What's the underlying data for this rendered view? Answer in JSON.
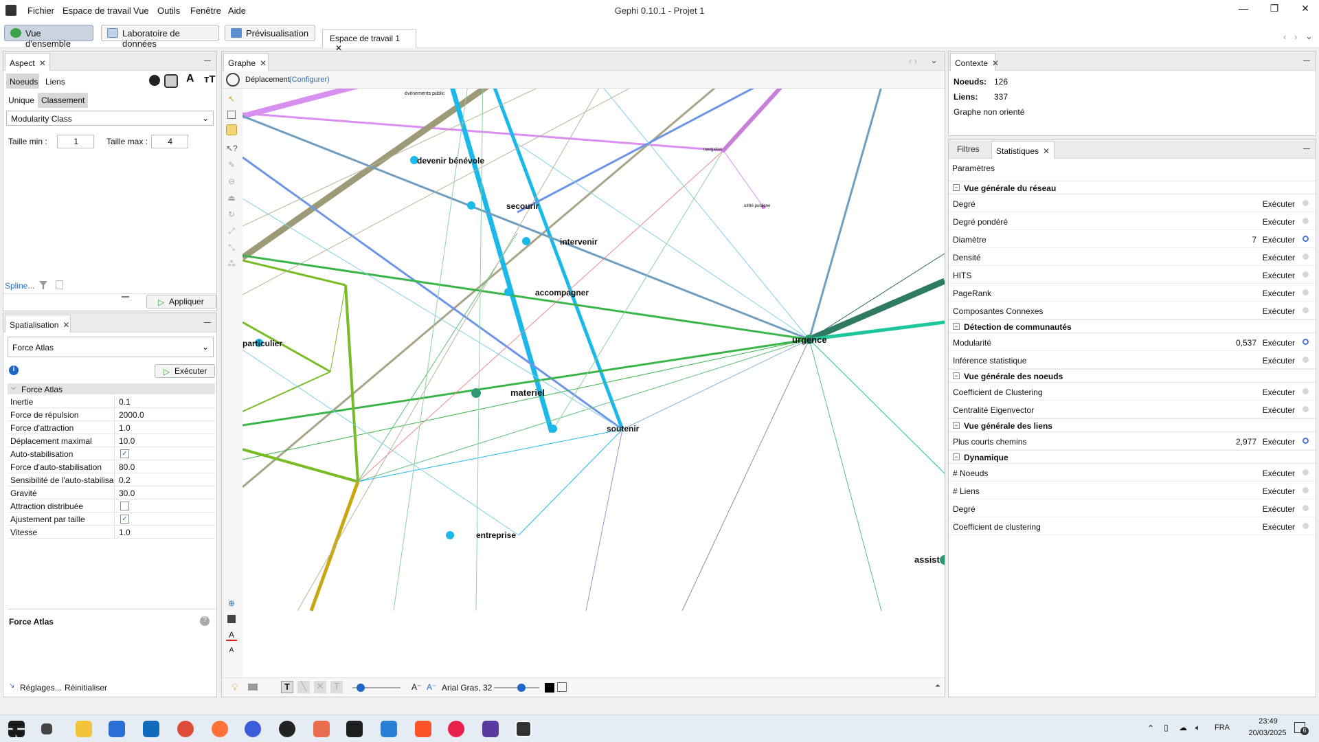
{
  "window": {
    "title": "Gephi 0.10.1 - Projet 1",
    "menu": [
      "Fichier",
      "Espace de travail",
      "Vue",
      "Outils",
      "Fenêtre",
      "Aide"
    ]
  },
  "toolbar": {
    "overview": "Vue d'ensemble",
    "data_lab": "Laboratoire de données",
    "preview": "Prévisualisation",
    "workspace_tab": "Espace de travail 1"
  },
  "aspect": {
    "tab": "Aspect",
    "nodes": "Noeuds",
    "links": "Liens",
    "unique": "Unique",
    "ranking": "Classement",
    "attribute": "Modularity Class",
    "size_min_label": "Taille min :",
    "size_min": "1",
    "size_max_label": "Taille max :",
    "size_max": "4",
    "spline": "Spline...",
    "apply": "Appliquer"
  },
  "layout": {
    "tab": "Spatialisation",
    "algorithm": "Force Atlas",
    "run": "Exécuter",
    "group": "Force Atlas",
    "props": [
      {
        "k": "Inertie",
        "v": "0.1"
      },
      {
        "k": "Force de répulsion",
        "v": "2000.0"
      },
      {
        "k": "Force d'attraction",
        "v": "1.0"
      },
      {
        "k": "Déplacement maximal",
        "v": "10.0"
      },
      {
        "k": "Auto-stabilisation",
        "v": ""
      },
      {
        "k": "Force d'auto-stabilisation",
        "v": "80.0"
      },
      {
        "k": "Sensibilité de l'auto-stabilisa",
        "v": "0.2"
      },
      {
        "k": "Gravité",
        "v": "30.0"
      },
      {
        "k": "Attraction distribuée",
        "v": ""
      },
      {
        "k": "Ajustement par taille",
        "v": ""
      },
      {
        "k": "Vitesse",
        "v": "1.0"
      }
    ],
    "desc_title": "Force Atlas",
    "settings": "Réglages...",
    "reset": "Réinitialiser"
  },
  "graph": {
    "tab": "Graphe",
    "mode": "Déplacement",
    "configure": "(Configurer)",
    "font": "Arial Gras, 32",
    "labels": [
      "évènements public",
      "devenir bénévole",
      "secourir",
      "intervenir",
      "accompagner",
      "urgence",
      "particulier",
      "materiel",
      "soutenir",
      "entreprise",
      "assist",
      "navigation",
      "utilité publique"
    ]
  },
  "context": {
    "tab": "Contexte",
    "nodes_label": "Noeuds:",
    "nodes": "126",
    "edges_label": "Liens:",
    "edges": "337",
    "type": "Graphe non orienté"
  },
  "stats": {
    "filters_tab": "Filtres",
    "stats_tab": "Statistiques",
    "params": "Paramètres",
    "run": "Exécuter",
    "groups": [
      {
        "title": "Vue générale du réseau",
        "items": [
          {
            "n": "Degré",
            "v": ""
          },
          {
            "n": "Degré pondéré",
            "v": ""
          },
          {
            "n": "Diamètre",
            "v": "7"
          },
          {
            "n": "Densité",
            "v": ""
          },
          {
            "n": "HITS",
            "v": ""
          },
          {
            "n": "PageRank",
            "v": ""
          },
          {
            "n": "Composantes Connexes",
            "v": ""
          }
        ]
      },
      {
        "title": "Détection de communautés",
        "items": [
          {
            "n": "Modularité",
            "v": "0,537"
          },
          {
            "n": "Inférence statistique",
            "v": ""
          }
        ]
      },
      {
        "title": "Vue générale des noeuds",
        "items": [
          {
            "n": "Coefficient de Clustering",
            "v": ""
          },
          {
            "n": "Centralité Eigenvector",
            "v": ""
          }
        ]
      },
      {
        "title": "Vue générale des liens",
        "items": [
          {
            "n": "Plus courts chemins",
            "v": "2,977"
          }
        ]
      },
      {
        "title": "Dynamique",
        "items": [
          {
            "n": "# Noeuds",
            "v": ""
          },
          {
            "n": "# Liens",
            "v": ""
          },
          {
            "n": "Degré",
            "v": ""
          },
          {
            "n": "Coefficient de clustering",
            "v": ""
          }
        ]
      }
    ]
  },
  "taskbar": {
    "lang": "FRA",
    "time": "23:49",
    "date": "20/03/2025",
    "notif": "6"
  }
}
